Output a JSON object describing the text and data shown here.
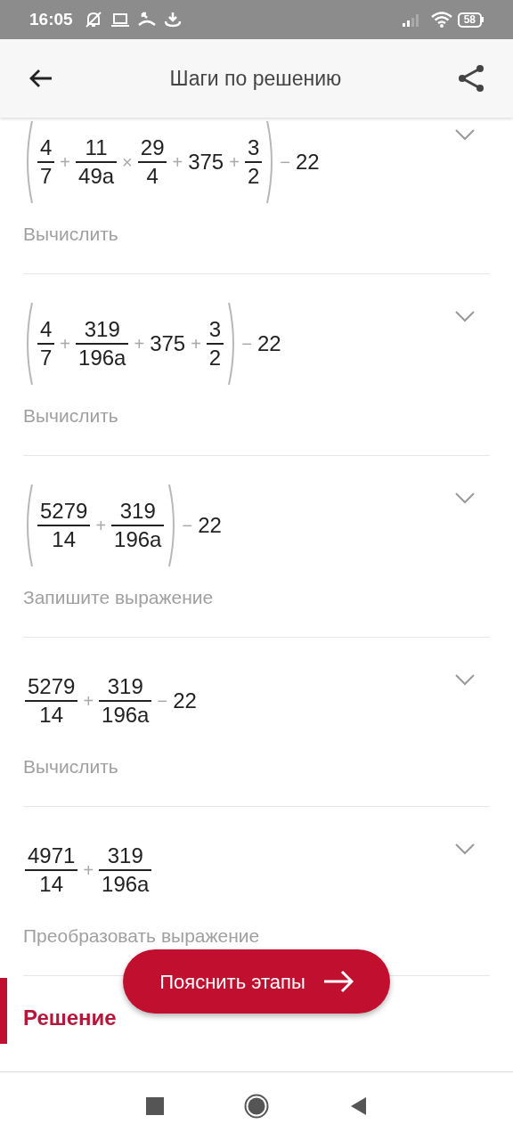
{
  "status_bar": {
    "time": "16:05",
    "battery": "58"
  },
  "header": {
    "title": "Шаги по решению"
  },
  "steps": [
    {
      "expression": [
        {
          "kind": "group",
          "items": [
            {
              "kind": "frac",
              "num": "4",
              "den": "7"
            },
            {
              "kind": "op",
              "text": "+"
            },
            {
              "kind": "frac",
              "num": "11",
              "den": "49a"
            },
            {
              "kind": "op",
              "text": "×"
            },
            {
              "kind": "frac",
              "num": "29",
              "den": "4"
            },
            {
              "kind": "op",
              "text": "+"
            },
            {
              "kind": "num",
              "text": "375"
            },
            {
              "kind": "op",
              "text": "+"
            },
            {
              "kind": "frac",
              "num": "3",
              "den": "2"
            }
          ]
        },
        {
          "kind": "op",
          "text": "−"
        },
        {
          "kind": "num",
          "text": "22"
        }
      ],
      "description": "Вычислить"
    },
    {
      "expression": [
        {
          "kind": "group",
          "items": [
            {
              "kind": "frac",
              "num": "4",
              "den": "7"
            },
            {
              "kind": "op",
              "text": "+"
            },
            {
              "kind": "frac",
              "num": "319",
              "den": "196a"
            },
            {
              "kind": "op",
              "text": "+"
            },
            {
              "kind": "num",
              "text": "375"
            },
            {
              "kind": "op",
              "text": "+"
            },
            {
              "kind": "frac",
              "num": "3",
              "den": "2"
            }
          ]
        },
        {
          "kind": "op",
          "text": "−"
        },
        {
          "kind": "num",
          "text": "22"
        }
      ],
      "description": "Вычислить"
    },
    {
      "expression": [
        {
          "kind": "group",
          "items": [
            {
              "kind": "frac",
              "num": "5279",
              "den": "14"
            },
            {
              "kind": "op",
              "text": "+"
            },
            {
              "kind": "frac",
              "num": "319",
              "den": "196a"
            }
          ]
        },
        {
          "kind": "op",
          "text": "−"
        },
        {
          "kind": "num",
          "text": "22"
        }
      ],
      "description": "Запишите выражение"
    },
    {
      "expression": [
        {
          "kind": "frac",
          "num": "5279",
          "den": "14"
        },
        {
          "kind": "op",
          "text": "+"
        },
        {
          "kind": "frac",
          "num": "319",
          "den": "196a"
        },
        {
          "kind": "op",
          "text": "−"
        },
        {
          "kind": "num",
          "text": "22"
        }
      ],
      "description": "Вычислить"
    },
    {
      "expression": [
        {
          "kind": "frac",
          "num": "4971",
          "den": "14"
        },
        {
          "kind": "op",
          "text": "+"
        },
        {
          "kind": "frac",
          "num": "319",
          "den": "196a"
        }
      ],
      "description": "Преобразовать выражение"
    }
  ],
  "solution": {
    "title": "Решение"
  },
  "fab": {
    "label": "Пояснить этапы"
  }
}
